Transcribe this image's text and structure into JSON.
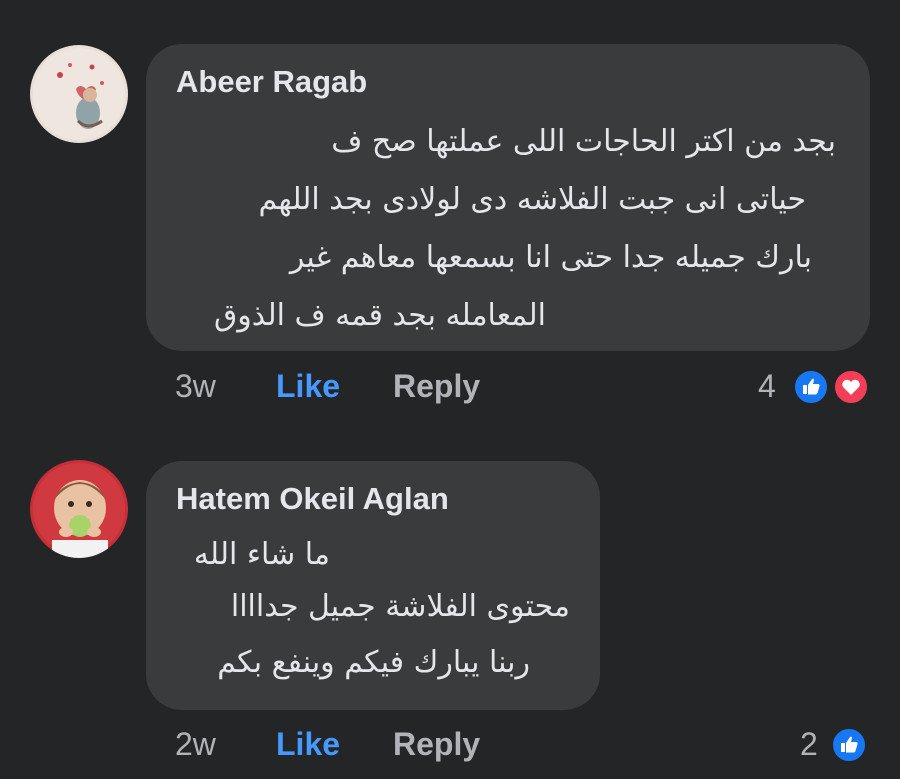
{
  "comments": [
    {
      "author": "Abeer Ragab",
      "lines": [
        "بجد من اكتر الحاجات اللى عملتها صح ف",
        "حياتى انى جبت الفلاشه دى لولادى بجد اللهم",
        "بارك جميله جدا حتى انا بسمعها معاهم غير",
        "المعامله بجد قمه ف الذوق"
      ],
      "time": "3w",
      "like_label": "Like",
      "reply_label": "Reply",
      "reaction_count": "4",
      "reactions": [
        "like-icon",
        "love-icon"
      ]
    },
    {
      "author": "Hatem Okeil Aglan",
      "lines": [
        "ما شاء الله",
        "محتوى الفلاشة جميل جداااا",
        "ربنا يبارك فيكم وينفع بكم"
      ],
      "time": "2w",
      "like_label": "Like",
      "reply_label": "Reply",
      "reaction_count": "2",
      "reactions": [
        "like-icon"
      ]
    }
  ],
  "colors": {
    "background": "#242526",
    "bubble": "#3a3b3c",
    "text": "#e4e6eb",
    "muted": "#b0b3b8",
    "like_blue": "#4599ff",
    "love_red": "#f33e58"
  }
}
